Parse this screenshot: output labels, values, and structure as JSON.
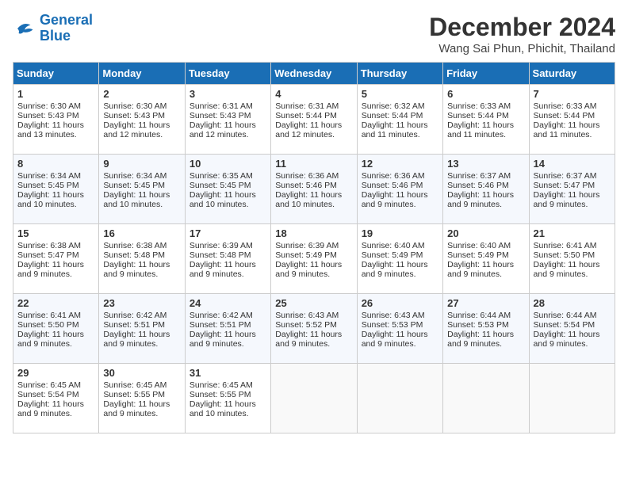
{
  "header": {
    "logo_line1": "General",
    "logo_line2": "Blue",
    "month_title": "December 2024",
    "location": "Wang Sai Phun, Phichit, Thailand"
  },
  "days_of_week": [
    "Sunday",
    "Monday",
    "Tuesday",
    "Wednesday",
    "Thursday",
    "Friday",
    "Saturday"
  ],
  "weeks": [
    [
      {
        "day": 1,
        "sunrise": "6:30 AM",
        "sunset": "5:43 PM",
        "daylight": "11 hours and 13 minutes."
      },
      {
        "day": 2,
        "sunrise": "6:30 AM",
        "sunset": "5:43 PM",
        "daylight": "11 hours and 12 minutes."
      },
      {
        "day": 3,
        "sunrise": "6:31 AM",
        "sunset": "5:43 PM",
        "daylight": "11 hours and 12 minutes."
      },
      {
        "day": 4,
        "sunrise": "6:31 AM",
        "sunset": "5:44 PM",
        "daylight": "11 hours and 12 minutes."
      },
      {
        "day": 5,
        "sunrise": "6:32 AM",
        "sunset": "5:44 PM",
        "daylight": "11 hours and 11 minutes."
      },
      {
        "day": 6,
        "sunrise": "6:33 AM",
        "sunset": "5:44 PM",
        "daylight": "11 hours and 11 minutes."
      },
      {
        "day": 7,
        "sunrise": "6:33 AM",
        "sunset": "5:44 PM",
        "daylight": "11 hours and 11 minutes."
      }
    ],
    [
      {
        "day": 8,
        "sunrise": "6:34 AM",
        "sunset": "5:45 PM",
        "daylight": "11 hours and 10 minutes."
      },
      {
        "day": 9,
        "sunrise": "6:34 AM",
        "sunset": "5:45 PM",
        "daylight": "11 hours and 10 minutes."
      },
      {
        "day": 10,
        "sunrise": "6:35 AM",
        "sunset": "5:45 PM",
        "daylight": "11 hours and 10 minutes."
      },
      {
        "day": 11,
        "sunrise": "6:36 AM",
        "sunset": "5:46 PM",
        "daylight": "11 hours and 10 minutes."
      },
      {
        "day": 12,
        "sunrise": "6:36 AM",
        "sunset": "5:46 PM",
        "daylight": "11 hours and 9 minutes."
      },
      {
        "day": 13,
        "sunrise": "6:37 AM",
        "sunset": "5:46 PM",
        "daylight": "11 hours and 9 minutes."
      },
      {
        "day": 14,
        "sunrise": "6:37 AM",
        "sunset": "5:47 PM",
        "daylight": "11 hours and 9 minutes."
      }
    ],
    [
      {
        "day": 15,
        "sunrise": "6:38 AM",
        "sunset": "5:47 PM",
        "daylight": "11 hours and 9 minutes."
      },
      {
        "day": 16,
        "sunrise": "6:38 AM",
        "sunset": "5:48 PM",
        "daylight": "11 hours and 9 minutes."
      },
      {
        "day": 17,
        "sunrise": "6:39 AM",
        "sunset": "5:48 PM",
        "daylight": "11 hours and 9 minutes."
      },
      {
        "day": 18,
        "sunrise": "6:39 AM",
        "sunset": "5:49 PM",
        "daylight": "11 hours and 9 minutes."
      },
      {
        "day": 19,
        "sunrise": "6:40 AM",
        "sunset": "5:49 PM",
        "daylight": "11 hours and 9 minutes."
      },
      {
        "day": 20,
        "sunrise": "6:40 AM",
        "sunset": "5:49 PM",
        "daylight": "11 hours and 9 minutes."
      },
      {
        "day": 21,
        "sunrise": "6:41 AM",
        "sunset": "5:50 PM",
        "daylight": "11 hours and 9 minutes."
      }
    ],
    [
      {
        "day": 22,
        "sunrise": "6:41 AM",
        "sunset": "5:50 PM",
        "daylight": "11 hours and 9 minutes."
      },
      {
        "day": 23,
        "sunrise": "6:42 AM",
        "sunset": "5:51 PM",
        "daylight": "11 hours and 9 minutes."
      },
      {
        "day": 24,
        "sunrise": "6:42 AM",
        "sunset": "5:51 PM",
        "daylight": "11 hours and 9 minutes."
      },
      {
        "day": 25,
        "sunrise": "6:43 AM",
        "sunset": "5:52 PM",
        "daylight": "11 hours and 9 minutes."
      },
      {
        "day": 26,
        "sunrise": "6:43 AM",
        "sunset": "5:53 PM",
        "daylight": "11 hours and 9 minutes."
      },
      {
        "day": 27,
        "sunrise": "6:44 AM",
        "sunset": "5:53 PM",
        "daylight": "11 hours and 9 minutes."
      },
      {
        "day": 28,
        "sunrise": "6:44 AM",
        "sunset": "5:54 PM",
        "daylight": "11 hours and 9 minutes."
      }
    ],
    [
      {
        "day": 29,
        "sunrise": "6:45 AM",
        "sunset": "5:54 PM",
        "daylight": "11 hours and 9 minutes."
      },
      {
        "day": 30,
        "sunrise": "6:45 AM",
        "sunset": "5:55 PM",
        "daylight": "11 hours and 9 minutes."
      },
      {
        "day": 31,
        "sunrise": "6:45 AM",
        "sunset": "5:55 PM",
        "daylight": "11 hours and 10 minutes."
      },
      null,
      null,
      null,
      null
    ]
  ]
}
